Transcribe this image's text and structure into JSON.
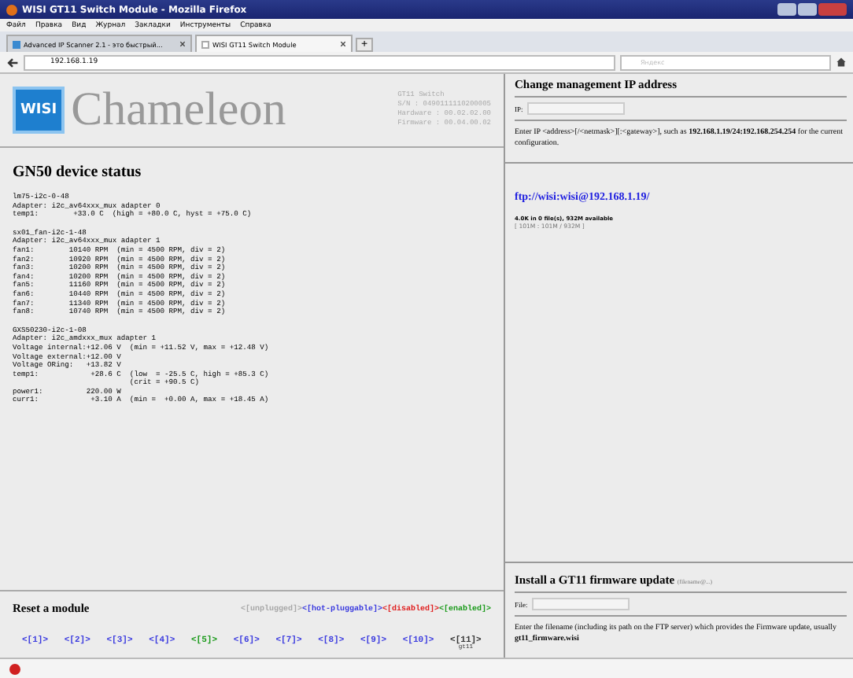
{
  "window": {
    "title": "WISI GT11 Switch Module - Mozilla Firefox"
  },
  "menu": [
    "Файл",
    "Правка",
    "Вид",
    "Журнал",
    "Закладки",
    "Инструменты",
    "Справка"
  ],
  "tabs": [
    {
      "label": "Advanced IP Scanner 2.1 - это быстрый...",
      "selected": false
    },
    {
      "label": "WISI GT11 Switch Module",
      "selected": true
    }
  ],
  "new_tab": "+",
  "address": "192.168.1.19",
  "search": {
    "placeholder": "Яндекс"
  },
  "header": {
    "logo": "WISI",
    "brand": "Chameleon",
    "info": [
      "GT11 Switch",
      "S/N : 0490111110200005",
      "Hardware : 00.02.02.00",
      "Firmware : 00.04.00.02"
    ]
  },
  "status": {
    "title": "GN50 device status",
    "blocks": [
      [
        "lm75-i2c-0-48",
        "Adapter: i2c_av64xxx_mux adapter 0",
        "temp1:        +33.0 C  (high = +80.0 C, hyst = +75.0 C)"
      ],
      [
        "sx01_fan-i2c-1-48",
        "Adapter: i2c_av64xxx_mux adapter 1",
        "fan1:        10140 RPM  (min = 4500 RPM, div = 2)",
        "fan2:        10920 RPM  (min = 4500 RPM, div = 2)",
        "fan3:        10200 RPM  (min = 4500 RPM, div = 2)",
        "fan4:        10200 RPM  (min = 4500 RPM, div = 2)",
        "fan5:        11160 RPM  (min = 4500 RPM, div = 2)",
        "fan6:        10440 RPM  (min = 4500 RPM, div = 2)",
        "fan7:        11340 RPM  (min = 4500 RPM, div = 2)",
        "fan8:        10740 RPM  (min = 4500 RPM, div = 2)"
      ],
      [
        "GXS50230-i2c-1-08",
        "Adapter: i2c_amdxxx_mux adapter 1",
        "Voltage internal:+12.06 V  (min = +11.52 V, max = +12.48 V)",
        "Voltage external:+12.00 V",
        "Voltage ORing:   +13.82 V",
        "temp1:            +28.6 C  (low  = -25.5 C, high = +85.3 C)",
        "                           (crit = +90.5 C)",
        "power1:          220.00 W",
        "curr1:            +3.10 A  (min =  +0.00 A, max = +18.45 A)"
      ]
    ]
  },
  "reset": {
    "title": "Reset a module",
    "legend": [
      {
        "label": "<[unplugged]>",
        "color": "#a8a8a8"
      },
      {
        "label": "<[hot-pluggable]>",
        "color": "#3a3adf"
      },
      {
        "label": "<[disabled]>",
        "color": "#e02020"
      },
      {
        "label": "<[enabled]>",
        "color": "#1a9a1a"
      }
    ],
    "modules": [
      {
        "label": "<[1]>",
        "color": "#3a3adf"
      },
      {
        "label": "<[2]>",
        "color": "#3a3adf"
      },
      {
        "label": "<[3]>",
        "color": "#3a3adf"
      },
      {
        "label": "<[4]>",
        "color": "#3a3adf"
      },
      {
        "label": "<[5]>",
        "color": "#1a9a1a"
      },
      {
        "label": "<[6]>",
        "color": "#3a3adf"
      },
      {
        "label": "<[7]>",
        "color": "#3a3adf"
      },
      {
        "label": "<[8]>",
        "color": "#3a3adf"
      },
      {
        "label": "<[9]>",
        "color": "#3a3adf"
      },
      {
        "label": "<[10]>",
        "color": "#3a3adf"
      },
      {
        "label": "<[11]>",
        "color": "#333333",
        "sub": "gt11"
      }
    ]
  },
  "ip_panel": {
    "title": "Change management IP address",
    "field_label": "IP:",
    "help": "Enter IP <address>[/<netmask>][:<gateway>], such as **192.168.1.19/24:192.168.254.254** for the current configuration."
  },
  "ftp": {
    "link": "ftp://wisi:wisi@192.168.1.19/",
    "usage": "4.0K in 0 file(s), 932M available",
    "quota": "[ 101M : 101M / 932M ]"
  },
  "firmware": {
    "title": "Install a GT11 firmware update",
    "hint": "(filename@...)",
    "field_label": "File:",
    "help": "Enter the filename (including its path on the FTP server) which provides the Firmware update, usually **gt11_firmware.wisi**"
  }
}
